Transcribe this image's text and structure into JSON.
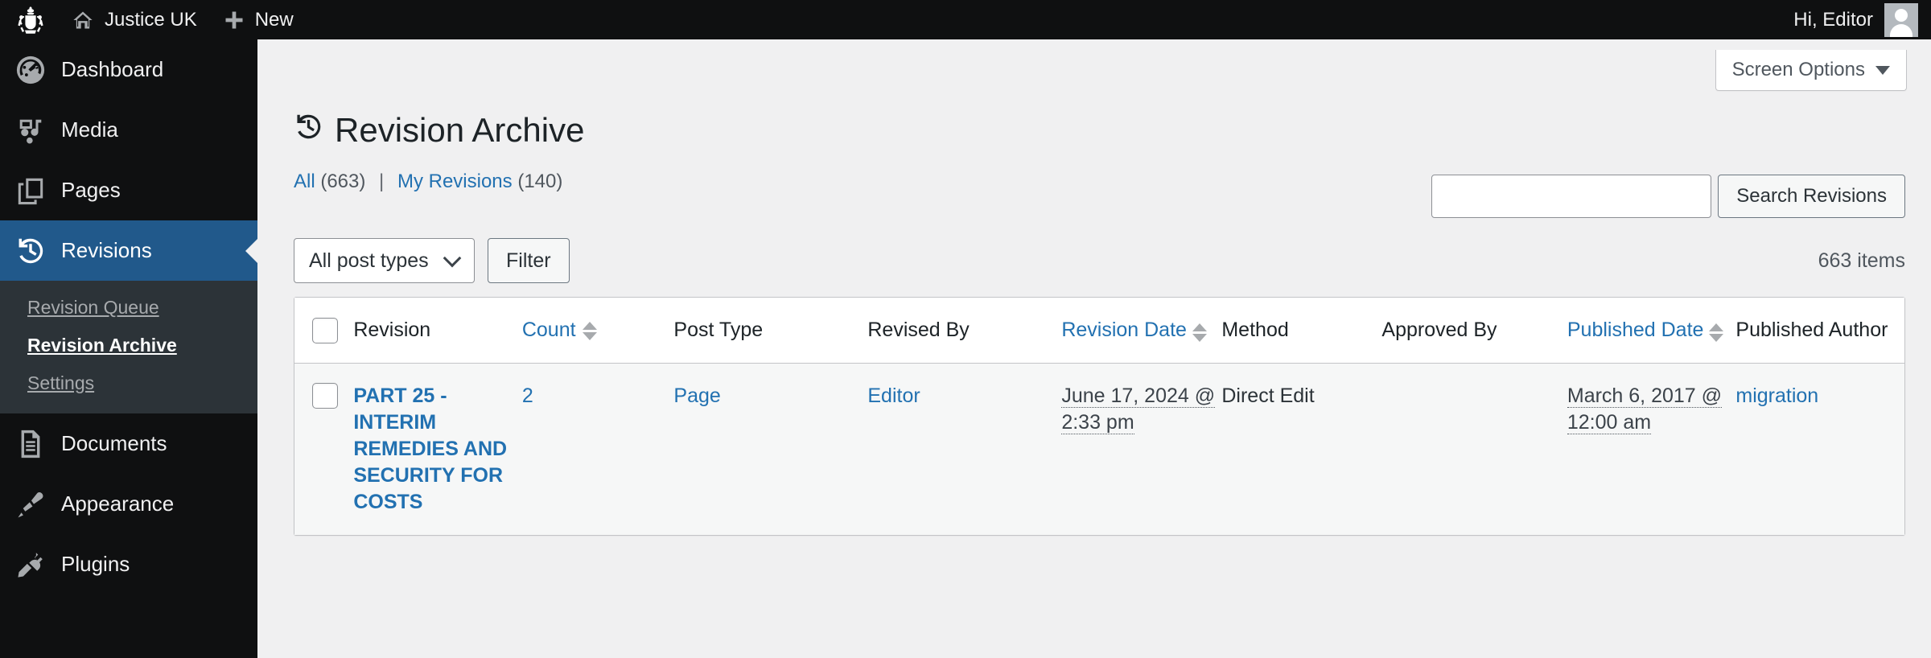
{
  "adminbar": {
    "logo_icon": "royal-crest-icon",
    "home_icon": "home-icon",
    "site_name": "Justice UK",
    "new_icon": "plus-icon",
    "new_label": "New",
    "greeting": "Hi, Editor",
    "avatar_icon": "user-avatar-icon"
  },
  "sidebar": {
    "items": [
      {
        "label": "Dashboard",
        "icon": "dashboard-icon",
        "current": false
      },
      {
        "label": "Media",
        "icon": "media-icon",
        "current": false
      },
      {
        "label": "Pages",
        "icon": "pages-icon",
        "current": false
      },
      {
        "label": "Revisions",
        "icon": "revisions-clock-icon",
        "current": true
      },
      {
        "label": "Documents",
        "icon": "documents-icon",
        "current": false
      },
      {
        "label": "Appearance",
        "icon": "appearance-brush-icon",
        "current": false
      },
      {
        "label": "Plugins",
        "icon": "plugins-plug-icon",
        "current": false
      }
    ],
    "submenu": [
      {
        "label": "Revision Queue",
        "current": false
      },
      {
        "label": "Revision Archive",
        "current": true
      },
      {
        "label": "Settings",
        "current": false
      }
    ]
  },
  "screen_options": {
    "label": "Screen Options",
    "caret_icon": "caret-down-icon"
  },
  "page": {
    "title": "Revision Archive",
    "title_icon": "revisions-clock-icon"
  },
  "views": {
    "all_label": "All",
    "all_count": "(663)",
    "separator": "|",
    "mine_label": "My Revisions",
    "mine_count": "(140)"
  },
  "search": {
    "value": "",
    "placeholder": "",
    "submit_label": "Search Revisions"
  },
  "tablenav": {
    "post_type_selected": "All post types",
    "post_type_options": [
      "All post types"
    ],
    "select_chevron_icon": "chevron-down-icon",
    "filter_label": "Filter",
    "displaying_num": "663 items"
  },
  "table": {
    "select_all_label": "Select All",
    "columns": [
      {
        "label": "Revision",
        "sortable": false,
        "stacked": false
      },
      {
        "label": "Count",
        "sortable": true,
        "stacked": false
      },
      {
        "label": "Post Type",
        "sortable": false,
        "stacked": false
      },
      {
        "label": "Revised By",
        "sortable": false,
        "stacked": false
      },
      {
        "label": "Revision Date",
        "sortable": true,
        "stacked": true
      },
      {
        "label": "Method",
        "sortable": false,
        "stacked": false
      },
      {
        "label": "Approved By",
        "sortable": false,
        "stacked": false
      },
      {
        "label": "Published Date",
        "sortable": true,
        "stacked": true
      },
      {
        "label": "Published Author",
        "sortable": false,
        "stacked": false
      }
    ],
    "rows": [
      {
        "title": "PART 25 - INTERIM REMEDIES AND SECURITY FOR COSTS",
        "count": "2",
        "post_type": "Page",
        "revised_by": "Editor",
        "revision_date": "June 17, 2024 @ 2:33 pm",
        "method": "Direct Edit",
        "approved_by": "",
        "published_date": "March 6, 2017 @ 12:00 am",
        "published_author": "migration"
      }
    ]
  },
  "colors": {
    "admin_bar": "#0f1011",
    "sidebar": "#0f1011",
    "sidebar_current": "#21598b",
    "link": "#2271b1",
    "row_bg": "#f6f7f7",
    "page_bg": "#f0f0f1"
  }
}
